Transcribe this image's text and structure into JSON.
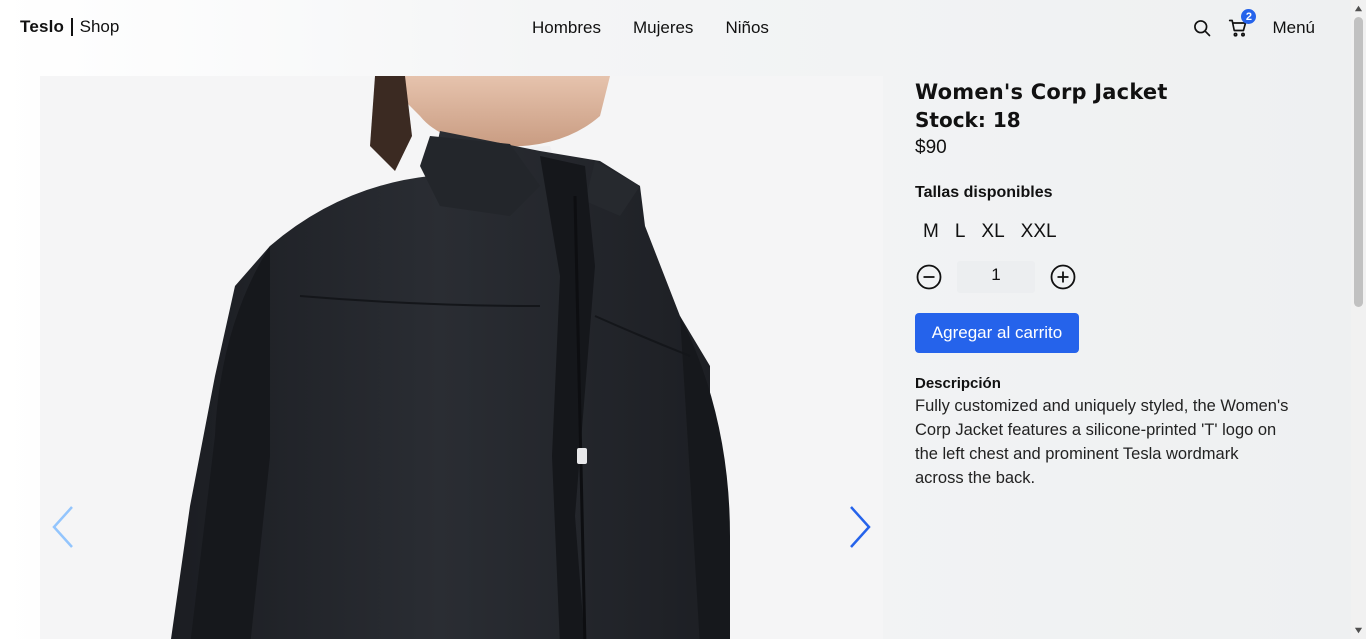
{
  "header": {
    "brand": "Teslo",
    "brand_suffix": "Shop",
    "nav": [
      {
        "label": "Hombres"
      },
      {
        "label": "Mujeres"
      },
      {
        "label": "Niños"
      }
    ],
    "cart_count": "2",
    "menu_label": "Menú",
    "icons": [
      "search-icon",
      "cart-icon"
    ]
  },
  "product": {
    "title": "Women's Corp Jacket",
    "stock": "Stock: 18",
    "price": "$90",
    "sizes_label": "Tallas disponibles",
    "sizes": [
      "M",
      "L",
      "XL",
      "XXL"
    ],
    "quantity": "1",
    "add_to_cart": "Agregar al carrito",
    "description_label": "Descripción",
    "description": "Fully customized and uniquely styled, the Women's Corp Jacket features a silicone-printed 'T' logo on the left chest and prominent Tesla wordmark across the back."
  },
  "colors": {
    "accent": "#2563eb",
    "arrow_prev": "#93c5fd",
    "arrow_next": "#2563eb"
  }
}
